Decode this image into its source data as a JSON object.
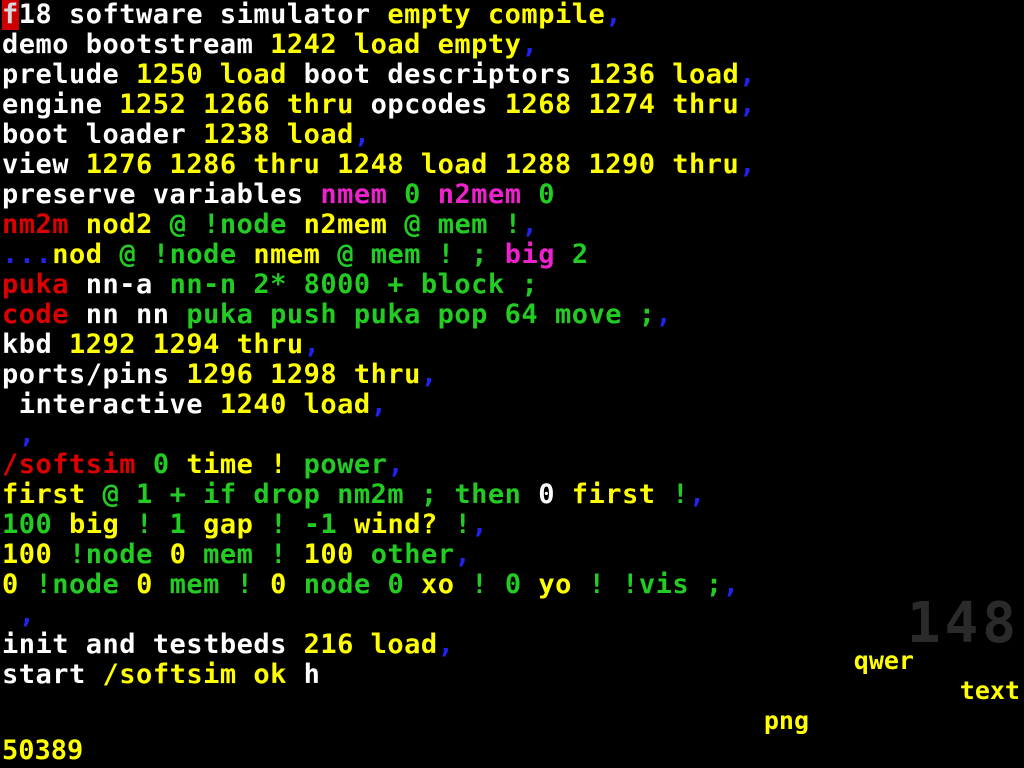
{
  "screen": {
    "background": "#000000",
    "block_number": "148",
    "stack_value": "50389"
  },
  "palette": {
    "white": "#ffffff",
    "yellow": "#ffff00",
    "green": "#22cc22",
    "red": "#dd0000",
    "magenta": "#ee22cc",
    "blue": "#2222ee",
    "gray": "#2a2a2a",
    "cursor_background": "#cc0000"
  },
  "floating_labels": {
    "qwer": "qwer",
    "text": "text",
    "png": "png"
  },
  "block": {
    "lines": [
      {
        "index": 0,
        "text": "f18 software simulator empty compile,",
        "tokens": [
          {
            "t": "f",
            "c": "cursor"
          },
          {
            "t": "18 software simulator ",
            "c": "white"
          },
          {
            "t": "empty compile",
            "c": "yellow"
          },
          {
            "t": ",",
            "c": "blue"
          }
        ]
      },
      {
        "index": 1,
        "text": "demo bootstream 1242 load empty,",
        "tokens": [
          {
            "t": "demo bootstream ",
            "c": "white"
          },
          {
            "t": "1242 load empty",
            "c": "yellow"
          },
          {
            "t": ",",
            "c": "blue"
          }
        ]
      },
      {
        "index": 2,
        "text": "prelude 1250 load boot descriptors 1236 load,",
        "tokens": [
          {
            "t": "prelude ",
            "c": "white"
          },
          {
            "t": "1250 load ",
            "c": "yellow"
          },
          {
            "t": "boot descriptors ",
            "c": "white"
          },
          {
            "t": "1236 load",
            "c": "yellow"
          },
          {
            "t": ",",
            "c": "blue"
          }
        ]
      },
      {
        "index": 3,
        "text": "engine 1252 1266 thru opcodes 1268 1274 thru,",
        "tokens": [
          {
            "t": "engine ",
            "c": "white"
          },
          {
            "t": "1252 1266 thru ",
            "c": "yellow"
          },
          {
            "t": "opcodes ",
            "c": "white"
          },
          {
            "t": "1268 1274 thru",
            "c": "yellow"
          },
          {
            "t": ",",
            "c": "blue"
          }
        ]
      },
      {
        "index": 4,
        "text": "boot loader 1238 load,",
        "tokens": [
          {
            "t": "boot loader ",
            "c": "white"
          },
          {
            "t": "1238 load",
            "c": "yellow"
          },
          {
            "t": ",",
            "c": "blue"
          }
        ]
      },
      {
        "index": 5,
        "text": "view 1276 1286 thru 1248 load 1288 1290 thru,",
        "tokens": [
          {
            "t": "view ",
            "c": "white"
          },
          {
            "t": "1276 1286 thru 1248 load 1288 1290 thru",
            "c": "yellow"
          },
          {
            "t": ",",
            "c": "blue"
          }
        ]
      },
      {
        "index": 6,
        "text": "preserve variables nmem 0 n2mem 0",
        "tokens": [
          {
            "t": "preserve variables ",
            "c": "white"
          },
          {
            "t": "nmem",
            "c": "magenta"
          },
          {
            "t": " ",
            "c": "white"
          },
          {
            "t": "0",
            "c": "green"
          },
          {
            "t": " ",
            "c": "white"
          },
          {
            "t": "n2mem",
            "c": "magenta"
          },
          {
            "t": " ",
            "c": "white"
          },
          {
            "t": "0",
            "c": "green"
          }
        ]
      },
      {
        "index": 7,
        "text": "nm2m nod2 @ !node n2mem @ mem !,",
        "tokens": [
          {
            "t": "nm2m",
            "c": "red"
          },
          {
            "t": " ",
            "c": "white"
          },
          {
            "t": "nod2",
            "c": "yellow"
          },
          {
            "t": " ",
            "c": "white"
          },
          {
            "t": "@ !node",
            "c": "green"
          },
          {
            "t": " ",
            "c": "white"
          },
          {
            "t": "n2mem",
            "c": "yellow"
          },
          {
            "t": " ",
            "c": "white"
          },
          {
            "t": "@ mem !",
            "c": "green"
          },
          {
            "t": ",",
            "c": "blue"
          }
        ]
      },
      {
        "index": 8,
        "text": "...nod @ !node nmem @ mem ! ; big 2",
        "tokens": [
          {
            "t": "...",
            "c": "blue"
          },
          {
            "t": "nod",
            "c": "yellow"
          },
          {
            "t": " ",
            "c": "white"
          },
          {
            "t": "@ !node",
            "c": "green"
          },
          {
            "t": " ",
            "c": "white"
          },
          {
            "t": "nmem",
            "c": "yellow"
          },
          {
            "t": " ",
            "c": "white"
          },
          {
            "t": "@ mem ! ;",
            "c": "green"
          },
          {
            "t": " ",
            "c": "white"
          },
          {
            "t": "big",
            "c": "magenta"
          },
          {
            "t": " ",
            "c": "white"
          },
          {
            "t": "2",
            "c": "green"
          }
        ]
      },
      {
        "index": 9,
        "text": "puka nn-a nn-n 2* 8000 + block ;",
        "tokens": [
          {
            "t": "puka",
            "c": "red"
          },
          {
            "t": " nn-a",
            "c": "white"
          },
          {
            "t": " ",
            "c": "white"
          },
          {
            "t": "nn-n 2* 8000 + block ;",
            "c": "green"
          }
        ]
      },
      {
        "index": 10,
        "text": "code nn nn puka push puka pop 64 move ;,",
        "tokens": [
          {
            "t": "code",
            "c": "red"
          },
          {
            "t": " nn nn ",
            "c": "white"
          },
          {
            "t": "puka push puka pop 64 move ;",
            "c": "green"
          },
          {
            "t": ",",
            "c": "blue"
          }
        ]
      },
      {
        "index": 11,
        "text": "kbd 1292 1294 thru,",
        "tokens": [
          {
            "t": "kbd ",
            "c": "white"
          },
          {
            "t": "1292 1294 thru",
            "c": "yellow"
          },
          {
            "t": ",",
            "c": "blue"
          }
        ]
      },
      {
        "index": 12,
        "text": "ports/pins 1296 1298 thru,",
        "tokens": [
          {
            "t": "ports/pins ",
            "c": "white"
          },
          {
            "t": "1296 1298 thru",
            "c": "yellow"
          },
          {
            "t": ",",
            "c": "blue"
          }
        ]
      },
      {
        "index": 13,
        "text": " interactive 1240 load,",
        "tokens": [
          {
            "t": " interactive ",
            "c": "white"
          },
          {
            "t": "1240 load",
            "c": "yellow"
          },
          {
            "t": ",",
            "c": "blue"
          }
        ]
      },
      {
        "index": 14,
        "text": " ,",
        "tokens": [
          {
            "t": " ,",
            "c": "blue"
          }
        ]
      },
      {
        "index": 15,
        "text": "/softsim 0 time ! power,",
        "tokens": [
          {
            "t": "/softsim",
            "c": "red"
          },
          {
            "t": " ",
            "c": "white"
          },
          {
            "t": "0",
            "c": "green"
          },
          {
            "t": " ",
            "c": "white"
          },
          {
            "t": "time !",
            "c": "yellow"
          },
          {
            "t": " ",
            "c": "white"
          },
          {
            "t": "power",
            "c": "green"
          },
          {
            "t": ",",
            "c": "blue"
          }
        ]
      },
      {
        "index": 16,
        "text": "first @ 1 + if drop nm2m ; then 0 first !,",
        "tokens": [
          {
            "t": "first",
            "c": "yellow"
          },
          {
            "t": " ",
            "c": "white"
          },
          {
            "t": "@ 1 + if drop nm2m ; then",
            "c": "green"
          },
          {
            "t": " ",
            "c": "white"
          },
          {
            "t": "0",
            "c": "white"
          },
          {
            "t": " ",
            "c": "white"
          },
          {
            "t": "first",
            "c": "yellow"
          },
          {
            "t": " ",
            "c": "white"
          },
          {
            "t": "!",
            "c": "green"
          },
          {
            "t": ",",
            "c": "blue"
          }
        ]
      },
      {
        "index": 17,
        "text": "100 big ! 1 gap ! -1 wind? !,",
        "tokens": [
          {
            "t": "100",
            "c": "green"
          },
          {
            "t": " ",
            "c": "white"
          },
          {
            "t": "big",
            "c": "yellow"
          },
          {
            "t": " ",
            "c": "white"
          },
          {
            "t": "!",
            "c": "green"
          },
          {
            "t": " ",
            "c": "white"
          },
          {
            "t": "1",
            "c": "green"
          },
          {
            "t": " ",
            "c": "white"
          },
          {
            "t": "gap",
            "c": "yellow"
          },
          {
            "t": " ",
            "c": "white"
          },
          {
            "t": "!",
            "c": "green"
          },
          {
            "t": " ",
            "c": "white"
          },
          {
            "t": "-1",
            "c": "green"
          },
          {
            "t": " ",
            "c": "white"
          },
          {
            "t": "wind?",
            "c": "yellow"
          },
          {
            "t": " ",
            "c": "white"
          },
          {
            "t": "!",
            "c": "green"
          },
          {
            "t": ",",
            "c": "blue"
          }
        ]
      },
      {
        "index": 18,
        "text": "100 !node 0 mem ! 100 other,",
        "tokens": [
          {
            "t": "100",
            "c": "yellow"
          },
          {
            "t": " ",
            "c": "white"
          },
          {
            "t": "!node",
            "c": "green"
          },
          {
            "t": " ",
            "c": "white"
          },
          {
            "t": "0",
            "c": "yellow"
          },
          {
            "t": " ",
            "c": "white"
          },
          {
            "t": "mem !",
            "c": "green"
          },
          {
            "t": " ",
            "c": "white"
          },
          {
            "t": "100",
            "c": "yellow"
          },
          {
            "t": " ",
            "c": "white"
          },
          {
            "t": "other",
            "c": "green"
          },
          {
            "t": ",",
            "c": "blue"
          }
        ]
      },
      {
        "index": 19,
        "text": "0 !node 0 mem ! 0 node 0 xo ! 0 yo ! !vis ;,",
        "tokens": [
          {
            "t": "0",
            "c": "yellow"
          },
          {
            "t": " ",
            "c": "white"
          },
          {
            "t": "!node",
            "c": "green"
          },
          {
            "t": " ",
            "c": "white"
          },
          {
            "t": "0",
            "c": "yellow"
          },
          {
            "t": " ",
            "c": "white"
          },
          {
            "t": "mem !",
            "c": "green"
          },
          {
            "t": " ",
            "c": "white"
          },
          {
            "t": "0",
            "c": "yellow"
          },
          {
            "t": " ",
            "c": "white"
          },
          {
            "t": "node",
            "c": "green"
          },
          {
            "t": " ",
            "c": "white"
          },
          {
            "t": "0",
            "c": "green"
          },
          {
            "t": " ",
            "c": "white"
          },
          {
            "t": "xo",
            "c": "yellow"
          },
          {
            "t": " ",
            "c": "white"
          },
          {
            "t": "!",
            "c": "green"
          },
          {
            "t": " ",
            "c": "white"
          },
          {
            "t": "0",
            "c": "green"
          },
          {
            "t": " ",
            "c": "white"
          },
          {
            "t": "yo",
            "c": "yellow"
          },
          {
            "t": " ",
            "c": "white"
          },
          {
            "t": "! !vis ;",
            "c": "green"
          },
          {
            "t": ",",
            "c": "blue"
          }
        ]
      },
      {
        "index": 20,
        "text": " ,",
        "tokens": [
          {
            "t": " ,",
            "c": "blue"
          }
        ]
      },
      {
        "index": 21,
        "text": "init and testbeds 216 load,",
        "tokens": [
          {
            "t": "init and testbeds ",
            "c": "white"
          },
          {
            "t": "216 load",
            "c": "yellow"
          },
          {
            "t": ",",
            "c": "blue"
          }
        ]
      },
      {
        "index": 22,
        "text": "start /softsim ok h",
        "tokens": [
          {
            "t": "start ",
            "c": "white"
          },
          {
            "t": "/softsim ok ",
            "c": "yellow"
          },
          {
            "t": "h",
            "c": "white"
          }
        ]
      }
    ]
  }
}
